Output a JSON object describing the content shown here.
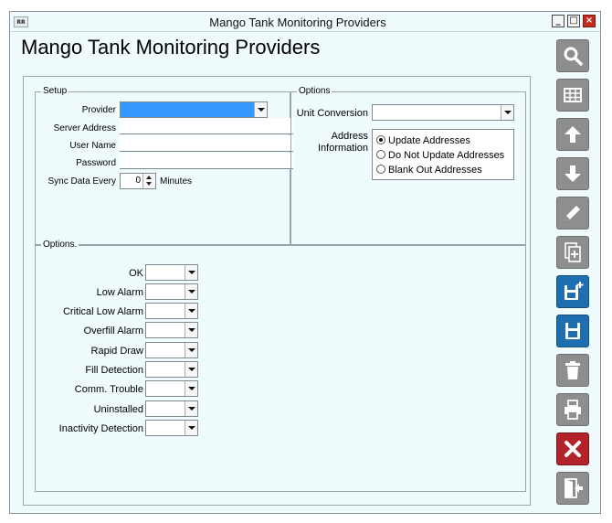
{
  "window": {
    "title": "Mango Tank Monitoring Providers",
    "logo_text": "RR"
  },
  "page": {
    "heading": "Mango Tank Monitoring Providers"
  },
  "setup": {
    "legend": "Setup",
    "provider_label": "Provider",
    "provider_value": "",
    "server_address_label": "Server Address",
    "server_address_value": "",
    "user_name_label": "User Name",
    "user_name_value": "",
    "password_label": "Password",
    "password_value": "",
    "sync_label": "Sync Data Every",
    "sync_value": "0",
    "sync_unit": "Minutes"
  },
  "options_right": {
    "legend": "Options",
    "unit_conversion_label": "Unit Conversion",
    "unit_conversion_value": "",
    "address_info_label_line1": "Address",
    "address_info_label_line2": "Information",
    "radios": [
      {
        "label": "Update Addresses",
        "selected": true
      },
      {
        "label": "Do Not Update Addresses",
        "selected": false
      },
      {
        "label": "Blank Out Addresses",
        "selected": false
      }
    ]
  },
  "options_bottom": {
    "legend": "Options.",
    "rows": [
      {
        "label": "OK",
        "value": ""
      },
      {
        "label": "Low Alarm",
        "value": ""
      },
      {
        "label": "Critical Low Alarm",
        "value": ""
      },
      {
        "label": "Overfill Alarm",
        "value": ""
      },
      {
        "label": "Rapid Draw",
        "value": ""
      },
      {
        "label": "Fill Detection",
        "value": ""
      },
      {
        "label": "Comm. Trouble",
        "value": ""
      },
      {
        "label": "Uninstalled",
        "value": ""
      },
      {
        "label": "Inactivity Detection",
        "value": ""
      }
    ]
  },
  "toolbar": [
    {
      "icon": "search-icon",
      "color": "#8e8e8e"
    },
    {
      "icon": "grid-icon",
      "color": "#8e8e8e"
    },
    {
      "icon": "arrow-up-icon",
      "color": "#8e8e8e"
    },
    {
      "icon": "arrow-down-icon",
      "color": "#8e8e8e"
    },
    {
      "icon": "pencil-icon",
      "color": "#8e8e8e"
    },
    {
      "icon": "copy-add-icon",
      "color": "#8e8e8e"
    },
    {
      "icon": "save-new-icon",
      "color": "#1f6fb0"
    },
    {
      "icon": "save-icon",
      "color": "#1f6fb0"
    },
    {
      "icon": "trash-icon",
      "color": "#8e8e8e"
    },
    {
      "icon": "print-icon",
      "color": "#8e8e8e"
    },
    {
      "icon": "cancel-icon",
      "color": "#b3232a"
    },
    {
      "icon": "exit-icon",
      "color": "#8e8e8e"
    }
  ]
}
